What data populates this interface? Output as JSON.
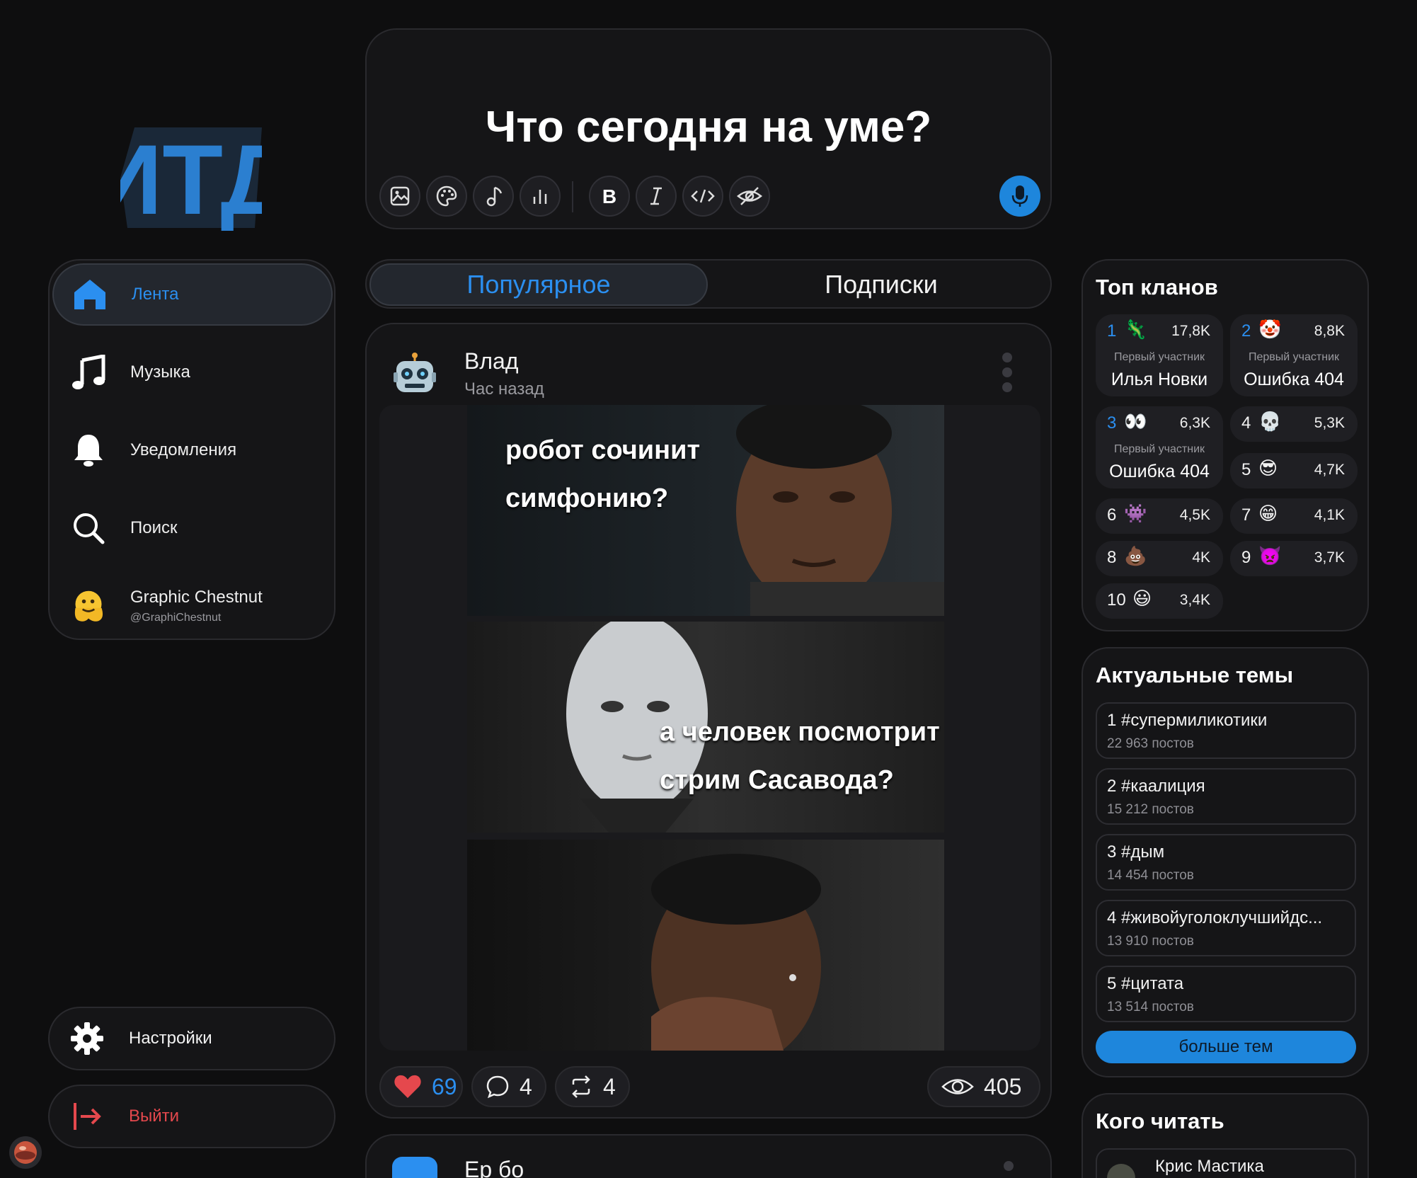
{
  "logo": {
    "text": "ИТД"
  },
  "nav": {
    "items": [
      {
        "label": "Лента",
        "icon": "home-icon",
        "active": true
      },
      {
        "label": "Музыка",
        "icon": "music-note-icon"
      },
      {
        "label": "Уведомления",
        "icon": "bell-icon"
      },
      {
        "label": "Поиск",
        "icon": "search-icon"
      }
    ],
    "profile": {
      "name": "Graphic Chestnut",
      "handle": "@GraphiChestnut",
      "avatar": "melting-face-emoji"
    },
    "settings_label": "Настройки",
    "logout_label": "Выйти"
  },
  "composer": {
    "prompt": "Что сегодня на уме?",
    "tools": [
      "image-icon",
      "palette-icon",
      "music-icon",
      "poll-icon",
      "bold-icon",
      "italic-icon",
      "code-icon",
      "spoiler-icon"
    ],
    "mic": "microphone-icon"
  },
  "feed_tabs": {
    "popular": "Популярное",
    "subscriptions": "Подписки",
    "active": "popular"
  },
  "post": {
    "author": "Влад",
    "time": "Час назад",
    "avatar": "🤖",
    "meme": {
      "text1": "робот сочинит",
      "text2": "симфонию?",
      "text3": "а человек посмотрит",
      "text4": "стрим Сасавода?"
    },
    "likes": "69",
    "comments": "4",
    "reposts": "4",
    "views": "405"
  },
  "next_post": {
    "author": "Ер бо"
  },
  "clans": {
    "title": "Топ кланов",
    "caption": "Первый участник",
    "top": [
      {
        "rank": "1",
        "emoji": "🦎",
        "count": "17,8K",
        "member": "Илья Новки"
      },
      {
        "rank": "2",
        "emoji": "🤡",
        "count": "8,8K",
        "member": "Ошибка 404"
      },
      {
        "rank": "3",
        "emoji": "👀",
        "count": "6,3K",
        "member": "Ошибка 404"
      }
    ],
    "rest": [
      {
        "rank": "4",
        "emoji": "💀",
        "count": "5,3K"
      },
      {
        "rank": "5",
        "emoji": "😎",
        "count": "4,7K"
      },
      {
        "rank": "6",
        "emoji": "👾",
        "count": "4,5K"
      },
      {
        "rank": "7",
        "emoji": "😁",
        "count": "4,1K"
      },
      {
        "rank": "8",
        "emoji": "💩",
        "count": "4K"
      },
      {
        "rank": "9",
        "emoji": "👿",
        "count": "3,7K"
      },
      {
        "rank": "10",
        "emoji": "😃",
        "count": "3,4K"
      }
    ]
  },
  "topics": {
    "title": "Актуальные темы",
    "items": [
      {
        "title": "1 #супермиликотики",
        "count": "22 963 постов"
      },
      {
        "title": "2 #каалиция",
        "count": "15 212 постов"
      },
      {
        "title": "3 #дым",
        "count": "14 454 постов"
      },
      {
        "title": "4 #живойуголоклучшийдс...",
        "count": "13 910 постов"
      },
      {
        "title": "5 #цитата",
        "count": "13 514 постов"
      }
    ],
    "more_label": "больше тем"
  },
  "who_to_follow": {
    "title": "Кого читать",
    "first": "Крис Мастика"
  },
  "colors": {
    "accent": "#1e86dc",
    "accent_text": "#2b8ff0",
    "danger": "#e5484d",
    "like": "#e5484d"
  }
}
